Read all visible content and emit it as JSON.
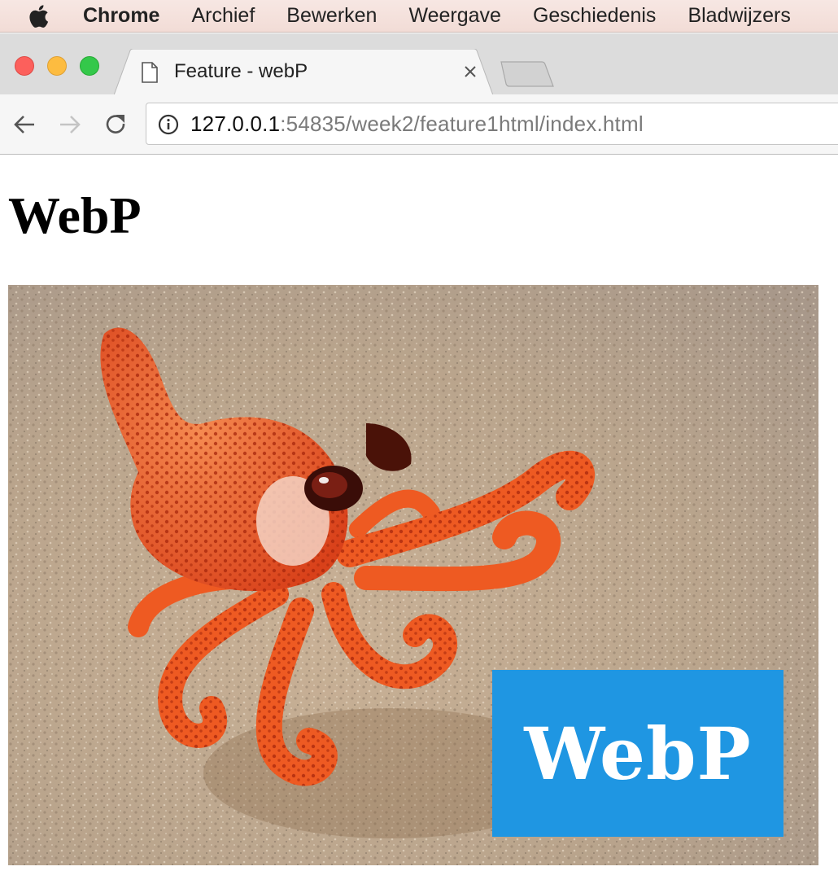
{
  "menubar": {
    "app_name": "Chrome",
    "items": [
      "Archief",
      "Bewerken",
      "Weergave",
      "Geschiedenis",
      "Bladwijzers"
    ]
  },
  "browser": {
    "tab": {
      "title": "Feature - webP",
      "icon": "file-icon"
    },
    "url_host": "127.0.0.1",
    "url_rest": ":54835/week2/feature1html/index.html"
  },
  "page": {
    "heading": "WebP",
    "image": {
      "logo_text": "WebP"
    }
  },
  "colors": {
    "logo_blue": "#1f96e2",
    "octopus_orange": "#ef5a1e",
    "sand": "#b8a48c"
  }
}
